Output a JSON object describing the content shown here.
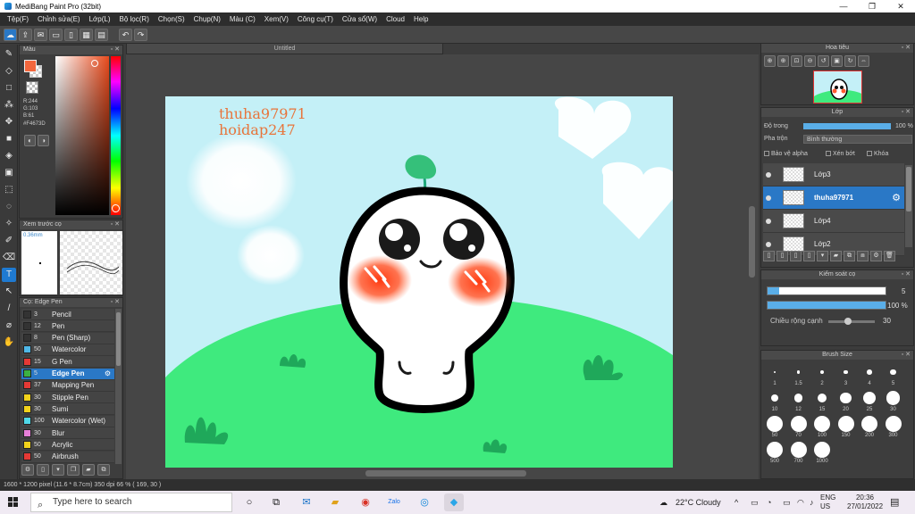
{
  "window": {
    "title": "MediBang Paint Pro (32bit)",
    "controls": [
      "—",
      "❐",
      "✕"
    ]
  },
  "menu": [
    "Tệp(F)",
    "Chỉnh sửa(E)",
    "Lớp(L)",
    "Bộ lọc(R)",
    "Chọn(S)",
    "Chụp(N)",
    "Màu (C)",
    "Xem(V)",
    "Công cụ(T)",
    "Cửa sổ(W)",
    "Cloud",
    "Help"
  ],
  "color_panel": {
    "title": "Màu",
    "main_color": "#F4673D",
    "r": "R:244",
    "g": "G:103",
    "b": "B:61",
    "hex": "#F4673D"
  },
  "preview_panel": {
    "title": "Xem trước cọ",
    "size": "0.36mm"
  },
  "brush_panel": {
    "title": "Cọ: Edge Pen",
    "brushes": [
      {
        "num": "3",
        "name": "Pencil",
        "color": "#333333"
      },
      {
        "num": "12",
        "name": "Pen",
        "color": "#333333"
      },
      {
        "num": "8",
        "name": "Pen (Sharp)",
        "color": "#333333"
      },
      {
        "num": "50",
        "name": "Watercolor",
        "color": "#4fb8e8"
      },
      {
        "num": "15",
        "name": "G Pen",
        "color": "#e53935"
      },
      {
        "num": "5",
        "name": "Edge Pen",
        "color": "#3cb043"
      },
      {
        "num": "37",
        "name": "Mapping Pen",
        "color": "#e53935"
      },
      {
        "num": "30",
        "name": "Stipple Pen",
        "color": "#f2d21b"
      },
      {
        "num": "30",
        "name": "Sumi",
        "color": "#f2d21b"
      },
      {
        "num": "100",
        "name": "Watercolor (Wet)",
        "color": "#4fd8e8"
      },
      {
        "num": "30",
        "name": "Blur",
        "color": "#e77fd8"
      },
      {
        "num": "50",
        "name": "Acrylic",
        "color": "#f2d21b"
      },
      {
        "num": "50",
        "name": "Airbrush",
        "color": "#e53935"
      }
    ],
    "active_index": 5
  },
  "canvas": {
    "tab_title": "Untitled",
    "watermark_1": "thuha97971",
    "watermark_2": "hoidap247"
  },
  "navigator": {
    "title": "Hoa tiêu"
  },
  "layer_panel": {
    "title": "Lớp",
    "opacity_label": "Độ trong",
    "opacity_value": "100 %",
    "blend_label": "Pha trộn",
    "blend_value": "Bình thường",
    "protect_alpha": "Bảo vệ alpha",
    "clipping": "Xén bớt",
    "lock": "Khóa",
    "layers": [
      {
        "name": "Lớp3"
      },
      {
        "name": "thuha97971"
      },
      {
        "name": "Lớp4"
      },
      {
        "name": "Lớp2"
      }
    ],
    "active_index": 1
  },
  "brush_control": {
    "title": "Kiểm soát cọ",
    "size_value": "5",
    "opacity_value": "100 %",
    "edge_label": "Chiều rộng cạnh",
    "edge_value": "30"
  },
  "brush_size": {
    "title": "Brush Size",
    "sizes": [
      "1",
      "1.5",
      "2",
      "3",
      "4",
      "5",
      "10",
      "12",
      "15",
      "20",
      "25",
      "30",
      "50",
      "70",
      "100",
      "150",
      "200",
      "300",
      "500",
      "700",
      "1000"
    ]
  },
  "statusbar": {
    "text": "1600 * 1200 pixel   (11.6 * 8.7cm)   350 dpi   66 %   ( 169, 30 )"
  },
  "taskbar": {
    "search_placeholder": "Type here to search",
    "weather": "22°C  Cloudy",
    "lang_1": "ENG",
    "lang_2": "US",
    "time": "20:36",
    "date": "27/01/2022"
  }
}
